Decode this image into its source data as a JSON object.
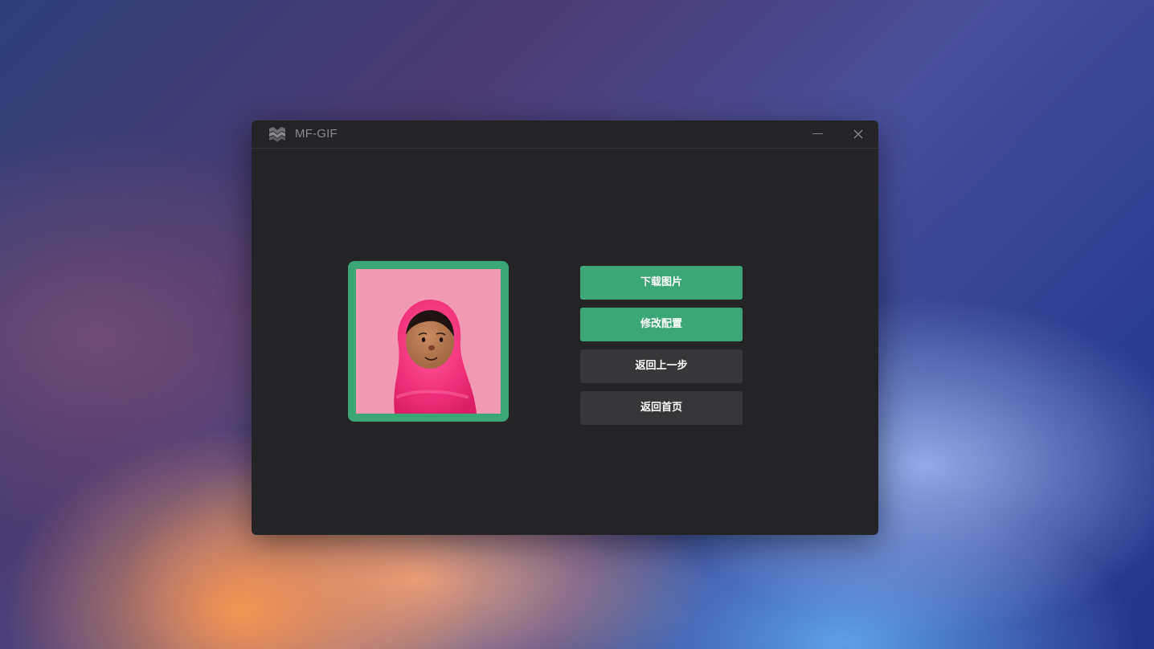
{
  "app": {
    "title": "MF-GIF",
    "logo_icon": "mf-logo-icon"
  },
  "window_controls": {
    "minimize_icon": "minimize-icon",
    "close_icon": "close-icon"
  },
  "preview": {
    "frame_color": "#3ca676",
    "image_background": "#f29ab4",
    "image_description_icon": "avatar-illustration"
  },
  "actions": {
    "download_label": "下载图片",
    "edit_config_label": "修改配置",
    "back_label": "返回上一步",
    "home_label": "返回首页"
  },
  "colors": {
    "accent": "#3ca676",
    "window_bg": "#242426",
    "secondary_button": "#373739"
  }
}
